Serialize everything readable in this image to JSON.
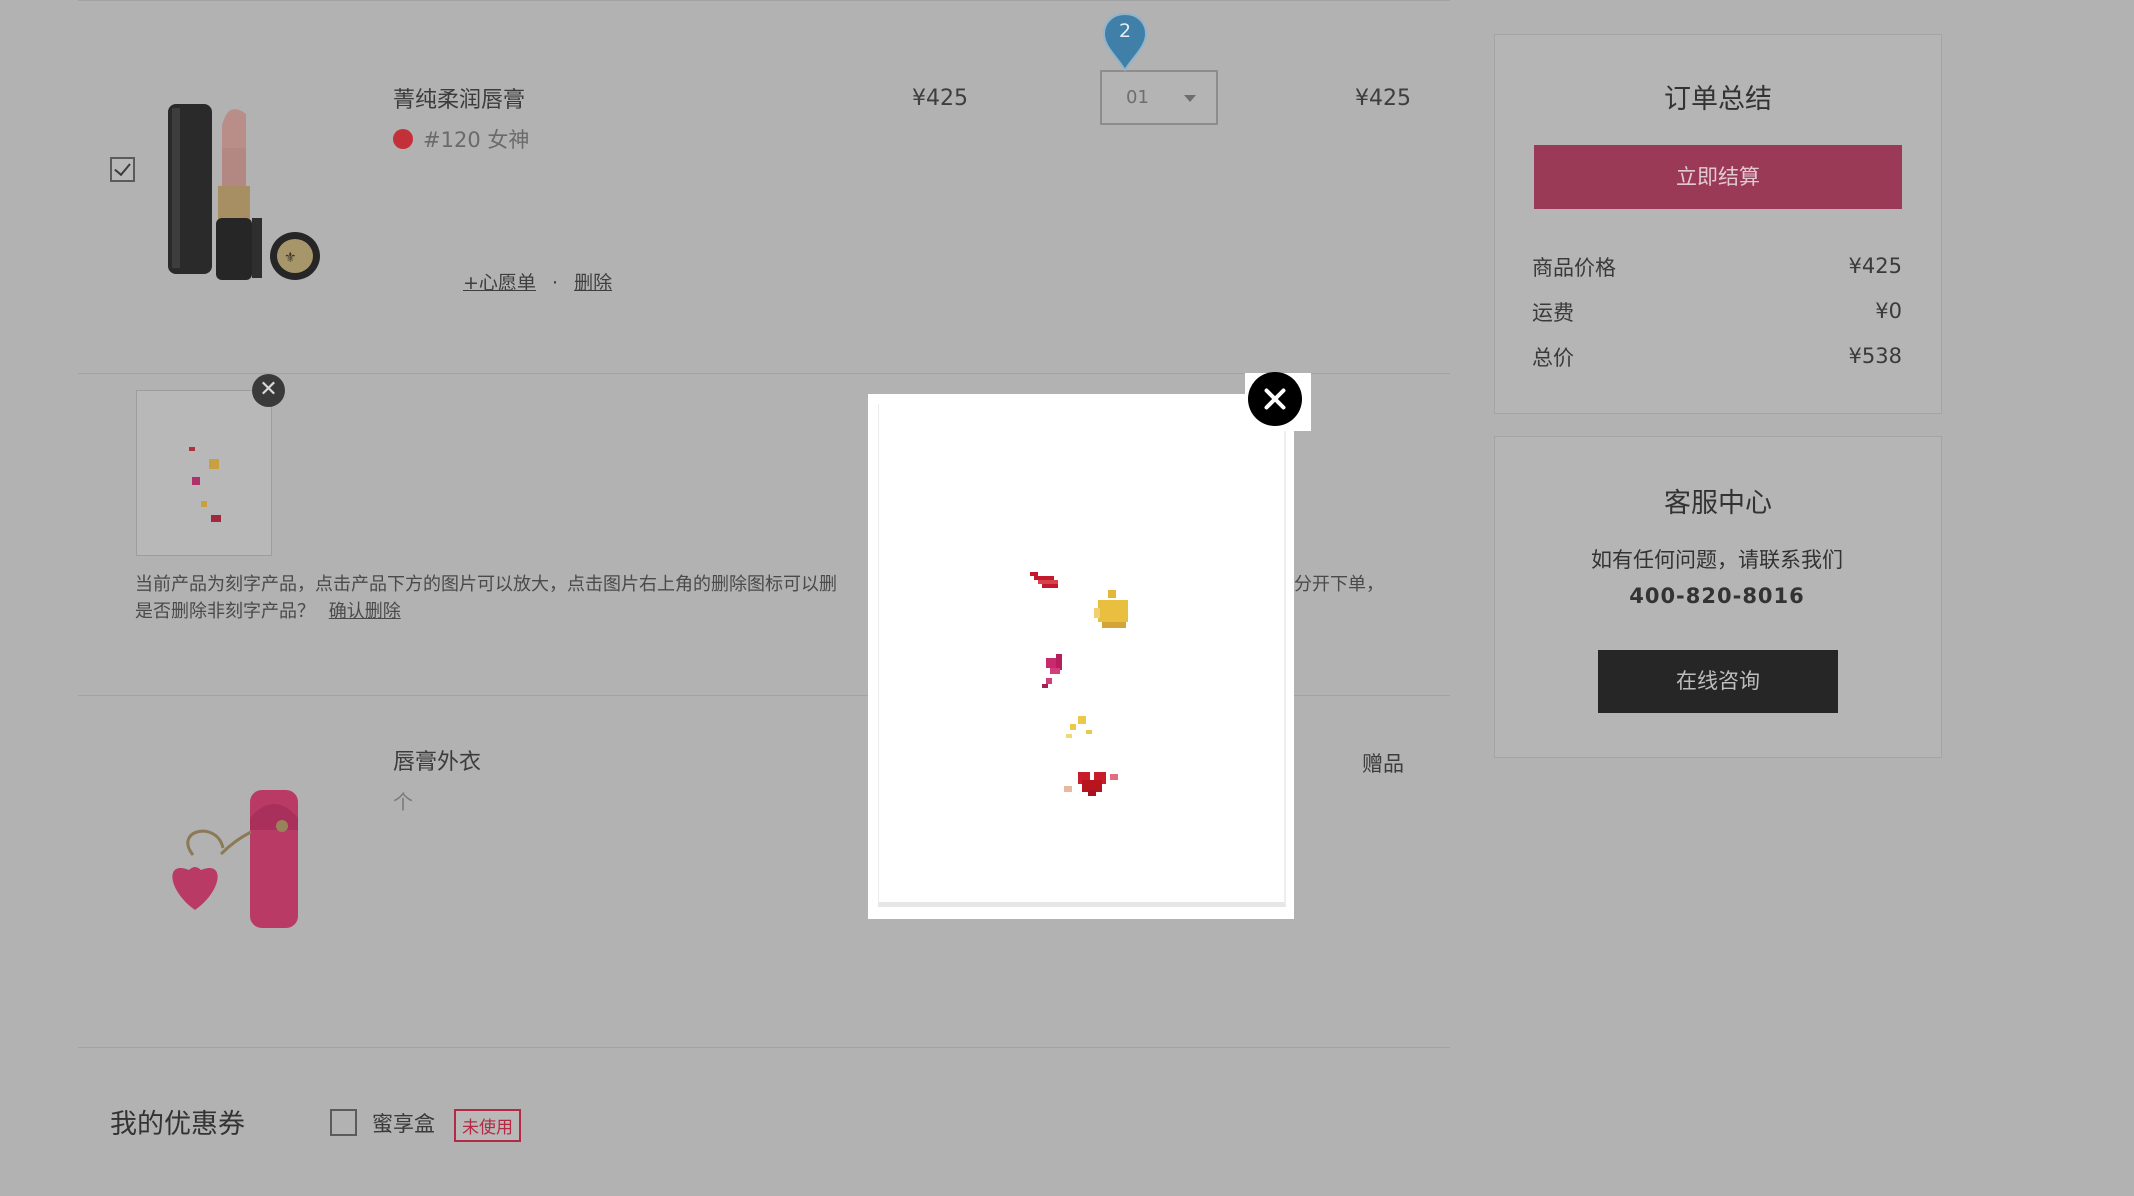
{
  "cart": {
    "item1": {
      "name": "菁纯柔润唇膏",
      "shade": "#120 女神",
      "unit_price": "¥425",
      "quantity": "01",
      "subtotal": "¥425",
      "add_wishlist": "+心愿单",
      "separator": "·",
      "delete": "删除",
      "selected": true
    },
    "engraving": {
      "notice_line1_left": "当前产品为刻字产品，点击产品下方的图片可以放大，点击图片右上角的删除图标可以删",
      "notice_line1_right": "分开下单，",
      "notice_line2": "是否删除非刻字产品？",
      "confirm_delete": "确认删除",
      "thumb_close": "✕"
    },
    "item2": {
      "name": "唇膏外衣",
      "unit": "个",
      "tag": "赠品"
    }
  },
  "step_marker": "2",
  "coupons": {
    "title": "我的优惠券",
    "option_label": "蜜享盒",
    "status": "未使用"
  },
  "summary": {
    "title": "订单总结",
    "checkout_button": "立即结算",
    "rows": [
      {
        "label": "商品价格",
        "value": "¥425"
      },
      {
        "label": "运费",
        "value": "¥0"
      },
      {
        "label": "总价",
        "value": "¥538"
      }
    ]
  },
  "service": {
    "title": "客服中心",
    "text": "如有任何问题，请联系我们",
    "phone": "400-820-8016",
    "consult_button": "在线咨询"
  },
  "colors": {
    "overlay": "#b2b2b2",
    "checkout": "#9a3a57",
    "coupon_status": "#b32a44",
    "shade_dot": "#c4303a",
    "pin": "#3f7fa8"
  }
}
